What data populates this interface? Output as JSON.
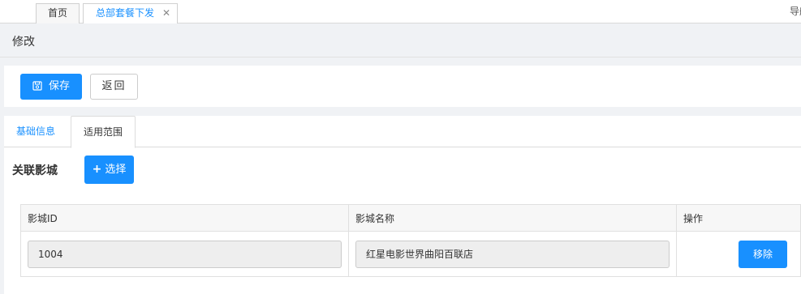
{
  "tabs_bar": {
    "home": "首页",
    "active_tab": "总部套餐下发",
    "close_glyph": "✕",
    "nav_edge": "导航"
  },
  "page": {
    "title": "修改"
  },
  "toolbar": {
    "save_label": "保存",
    "back_label": "返回"
  },
  "form_tabs": {
    "basic_info": "基础信息",
    "scope": "适用范围"
  },
  "section": {
    "label": "关联影城",
    "select_label": "选择"
  },
  "table": {
    "headers": [
      "影城ID",
      "影城名称",
      "操作"
    ],
    "rows": [
      {
        "id": "1004",
        "name": "红星电影世界曲阳百联店",
        "action": "移除"
      }
    ]
  },
  "colors": {
    "primary": "#1890ff",
    "background": "#f0f2f5"
  },
  "icons": {
    "save": "save-icon",
    "close": "close-icon",
    "plus": "plus-icon"
  }
}
